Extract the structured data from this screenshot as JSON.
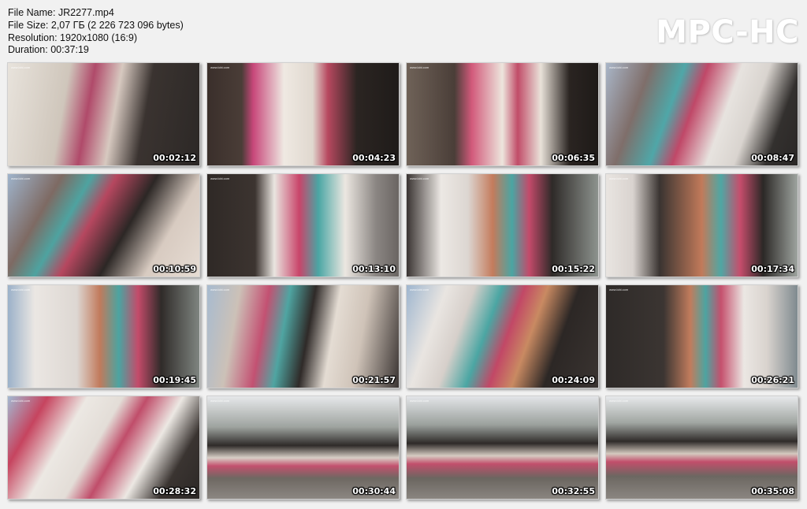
{
  "file_info": {
    "name_line": "File Name: JR2277.mp4",
    "size_line": "File Size: 2,07 ГБ (2 226 723 096 bytes)",
    "resolution_line": "Resolution: 1920x1080 (16:9)",
    "duration_line": "Duration: 00:37:19"
  },
  "logo": "MPC-HC",
  "thumbnails": [
    {
      "time": "00:02:12",
      "watermark": "www.lcbi.com",
      "bg": "#8a8f8e"
    },
    {
      "time": "00:04:23",
      "watermark": "www.lcbi.com",
      "bg": "#5e5450"
    },
    {
      "time": "00:06:35",
      "watermark": "www.lcbi.com",
      "bg": "#6d625b"
    },
    {
      "time": "00:08:47",
      "watermark": "www.lcbi.com",
      "bg": "#7c6f6a"
    },
    {
      "time": "00:10:59",
      "watermark": "www.lcbi.com",
      "bg": "#6b5f5f"
    },
    {
      "time": "00:13:10",
      "watermark": "www.lcbi.com",
      "bg": "#615a56"
    },
    {
      "time": "00:15:22",
      "watermark": "www.lcbi.com",
      "bg": "#6c6f6a"
    },
    {
      "time": "00:17:34",
      "watermark": "www.lcbi.com",
      "bg": "#6f706d"
    },
    {
      "time": "00:19:45",
      "watermark": "www.lcbi.com",
      "bg": "#73706c"
    },
    {
      "time": "00:21:57",
      "watermark": "www.lcbi.com",
      "bg": "#7a6e6a"
    },
    {
      "time": "00:24:09",
      "watermark": "www.lcbi.com",
      "bg": "#6e6462"
    },
    {
      "time": "00:26:21",
      "watermark": "www.lcbi.com",
      "bg": "#5f5a58"
    },
    {
      "time": "00:28:32",
      "watermark": "www.lcbi.com",
      "bg": "#6f6461"
    },
    {
      "time": "00:30:44",
      "watermark": "www.lcbi.com",
      "bg": "#6a6764"
    },
    {
      "time": "00:32:55",
      "watermark": "www.lcbi.com",
      "bg": "#676462"
    },
    {
      "time": "00:35:08",
      "watermark": "www.lcbi.com",
      "bg": "#666563"
    }
  ]
}
